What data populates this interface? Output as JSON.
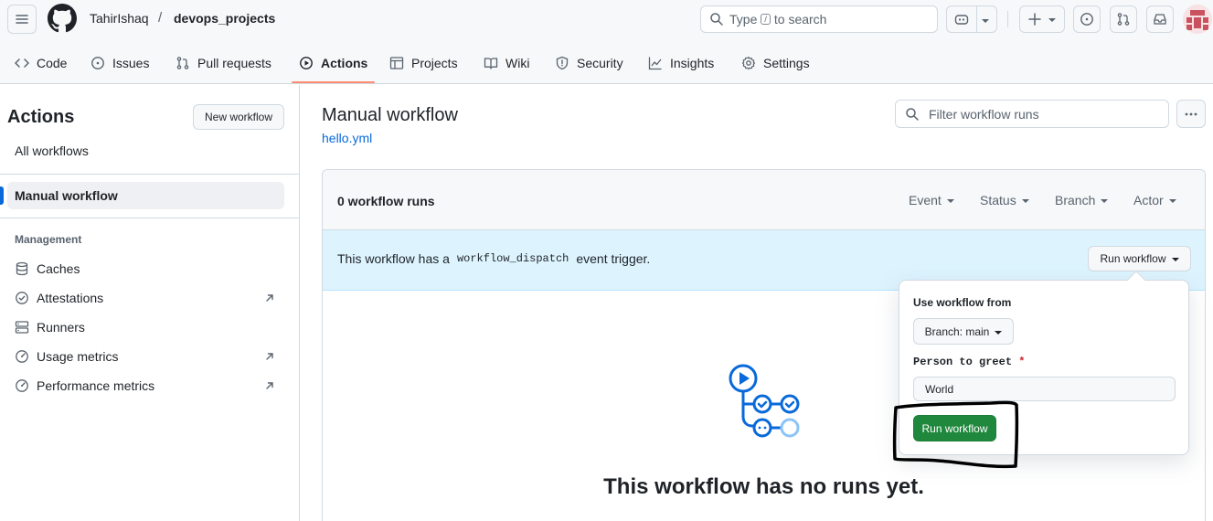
{
  "header": {
    "owner": "TahirIshaq",
    "separator": "/",
    "repo": "devops_projects",
    "search_prefix": "Type",
    "search_key": "/",
    "search_suffix": "to search"
  },
  "repo_nav": [
    {
      "label": "Code",
      "icon": "code-icon"
    },
    {
      "label": "Issues",
      "icon": "issue-icon"
    },
    {
      "label": "Pull requests",
      "icon": "pull-request-icon"
    },
    {
      "label": "Actions",
      "icon": "play-icon",
      "active": true
    },
    {
      "label": "Projects",
      "icon": "table-icon"
    },
    {
      "label": "Wiki",
      "icon": "book-icon"
    },
    {
      "label": "Security",
      "icon": "shield-icon"
    },
    {
      "label": "Insights",
      "icon": "graph-icon"
    },
    {
      "label": "Settings",
      "icon": "gear-icon"
    }
  ],
  "sidebar": {
    "title": "Actions",
    "new_workflow": "New workflow",
    "all_workflows": "All workflows",
    "active_workflow": "Manual workflow",
    "management_heading": "Management",
    "items": [
      {
        "label": "Caches",
        "icon": "database-icon",
        "external": false
      },
      {
        "label": "Attestations",
        "icon": "verified-icon",
        "external": true
      },
      {
        "label": "Runners",
        "icon": "server-icon",
        "external": false
      },
      {
        "label": "Usage metrics",
        "icon": "meter-icon",
        "external": true
      },
      {
        "label": "Performance metrics",
        "icon": "meter-icon",
        "external": true
      }
    ]
  },
  "main": {
    "title": "Manual workflow",
    "file": "hello.yml",
    "filter_placeholder": "Filter workflow runs",
    "runs_count": "0 workflow runs",
    "filters": [
      "Event",
      "Status",
      "Branch",
      "Actor"
    ],
    "dispatch_prefix": "This workflow has a",
    "dispatch_code": "workflow_dispatch",
    "dispatch_suffix": "event trigger.",
    "run_workflow": "Run workflow",
    "empty_title": "This workflow has no runs yet."
  },
  "dropdown": {
    "use_from": "Use workflow from",
    "branch": "Branch: main",
    "person_label": "Person to greet",
    "required_mark": "*",
    "person_value": "World",
    "submit": "Run workflow"
  },
  "colors": {
    "accent": "#0969da",
    "primary_button": "#1f883d",
    "tab_underline": "#fd8c73",
    "banner": "#ddf4ff"
  }
}
